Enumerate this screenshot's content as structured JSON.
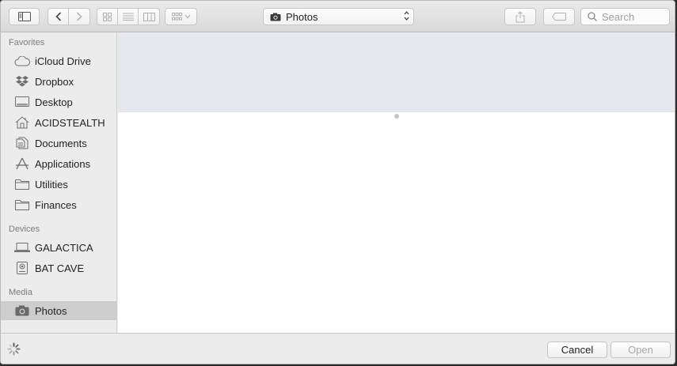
{
  "toolbar": {
    "location": "Photos",
    "search_placeholder": "Search"
  },
  "sidebar": {
    "sections": [
      {
        "title": "Favorites",
        "items": [
          {
            "label": "iCloud Drive",
            "icon": "cloud-icon"
          },
          {
            "label": "Dropbox",
            "icon": "dropbox-icon"
          },
          {
            "label": "Desktop",
            "icon": "desktop-icon"
          },
          {
            "label": "ACIDSTEALTH",
            "icon": "home-icon"
          },
          {
            "label": "Documents",
            "icon": "documents-icon"
          },
          {
            "label": "Applications",
            "icon": "applications-icon"
          },
          {
            "label": "Utilities",
            "icon": "folder-icon"
          },
          {
            "label": "Finances",
            "icon": "folder-icon"
          }
        ]
      },
      {
        "title": "Devices",
        "items": [
          {
            "label": "GALACTICA",
            "icon": "laptop-icon"
          },
          {
            "label": "BAT CAVE",
            "icon": "disk-icon"
          }
        ]
      },
      {
        "title": "Media",
        "items": [
          {
            "label": "Photos",
            "icon": "camera-icon",
            "selected": true
          }
        ]
      }
    ]
  },
  "buttons": {
    "cancel": "Cancel",
    "open": "Open"
  }
}
